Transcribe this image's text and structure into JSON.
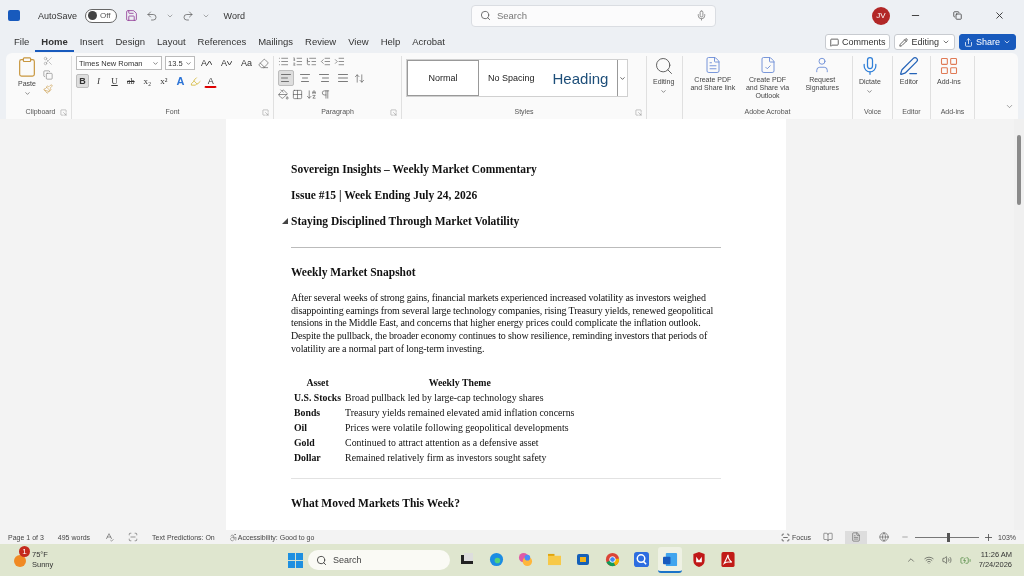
{
  "title_bar": {
    "autosave_label": "AutoSave",
    "autosave_state": "Off",
    "autosave_on": false,
    "app_name": "Word",
    "search_placeholder": "Search",
    "avatar": "JV"
  },
  "menu_tabs": [
    {
      "label": "File",
      "selected": false
    },
    {
      "label": "Home",
      "selected": true
    },
    {
      "label": "Insert",
      "selected": false
    },
    {
      "label": "Design",
      "selected": false
    },
    {
      "label": "Layout",
      "selected": false
    },
    {
      "label": "References",
      "selected": false
    },
    {
      "label": "Mailings",
      "selected": false
    },
    {
      "label": "Review",
      "selected": false
    },
    {
      "label": "View",
      "selected": false
    },
    {
      "label": "Help",
      "selected": false
    },
    {
      "label": "Acrobat",
      "selected": false
    }
  ],
  "actions": {
    "comments": "Comments",
    "editing": "Editing",
    "share": "Share"
  },
  "ribbon": {
    "clipboard": {
      "paste": "Paste",
      "group": "Clipboard"
    },
    "font": {
      "name": "Times New Roman",
      "size": "13.5",
      "grow": "A",
      "shrink": "A",
      "case": "Aa",
      "group": "Font",
      "format_buttons": [
        {
          "label": "B",
          "selected": true
        },
        {
          "label": "I",
          "selected": false
        },
        {
          "label": "U",
          "selected": false
        },
        {
          "label": "ab",
          "selected": false
        },
        {
          "label": "x₂",
          "selected": false
        },
        {
          "label": "x²",
          "selected": false
        }
      ],
      "effects": "A",
      "font_color": "A"
    },
    "paragraph": {
      "group": "Paragraph",
      "align": [
        {
          "kind": "left",
          "selected": true
        },
        {
          "kind": "center",
          "selected": false
        },
        {
          "kind": "right",
          "selected": false
        },
        {
          "kind": "justify",
          "selected": false
        }
      ]
    },
    "styles": {
      "group": "Styles",
      "items": [
        {
          "label": "Normal",
          "selected": true
        },
        {
          "label": "No Spacing",
          "selected": false
        },
        {
          "label": "Heading",
          "selected": false
        }
      ]
    },
    "editing": {
      "label": "Editing"
    },
    "acrobat": {
      "group": "Adobe Acrobat",
      "items": [
        {
          "label": "Create PDF and Share link"
        },
        {
          "label": "Create PDF and Share via Outlook"
        },
        {
          "label": "Request Signatures"
        }
      ]
    },
    "voice": {
      "label": "Dictate",
      "group": "Voice"
    },
    "editor": {
      "label": "Editor",
      "group": "Editor"
    },
    "addins": {
      "label": "Add-ins",
      "group": "Add-ins"
    }
  },
  "document": {
    "title": "Sovereign Insights – Weekly Market Commentary",
    "issue": "Issue #15 | Week Ending July 24, 2026",
    "collapsible_heading": {
      "text": "Staying Disciplined Through Market Volatility",
      "expanded": true
    },
    "section_heading": "Weekly Market Snapshot",
    "paragraph": "After several weeks of strong gains, financial markets experienced increased volatility as investors weighed disappointing earnings from several large technology companies, rising Treasury yields, renewed geopolitical tensions in the Middle East, and concerns that higher energy prices could complicate the inflation outlook. Despite the pullback, the broader economy continues to show resilience, reminding investors that periods of volatility are a normal part of long-term investing.",
    "table": {
      "columns": [
        "Asset",
        "Weekly Theme"
      ],
      "rows": [
        [
          "U.S. Stocks",
          "Broad pullback led by large-cap technology shares"
        ],
        [
          "Bonds",
          "Treasury yields remained elevated amid inflation concerns"
        ],
        [
          "Oil",
          "Prices were volatile following geopolitical developments"
        ],
        [
          "Gold",
          "Continued to attract attention as a defensive asset"
        ],
        [
          "Dollar",
          "Remained relatively firm as investors sought safety"
        ]
      ]
    },
    "next_heading": "What Moved Markets This Week?"
  },
  "status_bar": {
    "page": "Page 1 of 3",
    "words": "495 words",
    "predictions": "Text Predictions: On",
    "accessibility": "Accessibility: Good to go",
    "focus": "Focus",
    "views": [
      {
        "kind": "read",
        "selected": false
      },
      {
        "kind": "print",
        "selected": true
      },
      {
        "kind": "web",
        "selected": false
      }
    ],
    "zoom_slider": {
      "level": 0.5
    },
    "zoom": "103%"
  },
  "taskbar": {
    "temperature": "75°F",
    "condition": "Sunny",
    "badge": "1",
    "search_placeholder": "Search",
    "apps": [
      {
        "kind": "task-view",
        "selected": false
      },
      {
        "kind": "browser",
        "selected": false
      },
      {
        "kind": "copilot",
        "selected": false
      },
      {
        "kind": "folder",
        "selected": false
      },
      {
        "kind": "store",
        "selected": false
      },
      {
        "kind": "chrome",
        "selected": false
      },
      {
        "kind": "zoom",
        "selected": false
      },
      {
        "kind": "word",
        "selected": true
      },
      {
        "kind": "shield",
        "selected": false
      },
      {
        "kind": "pdf",
        "selected": false
      }
    ],
    "time": "11:26 AM",
    "date": "7/24/2026"
  }
}
